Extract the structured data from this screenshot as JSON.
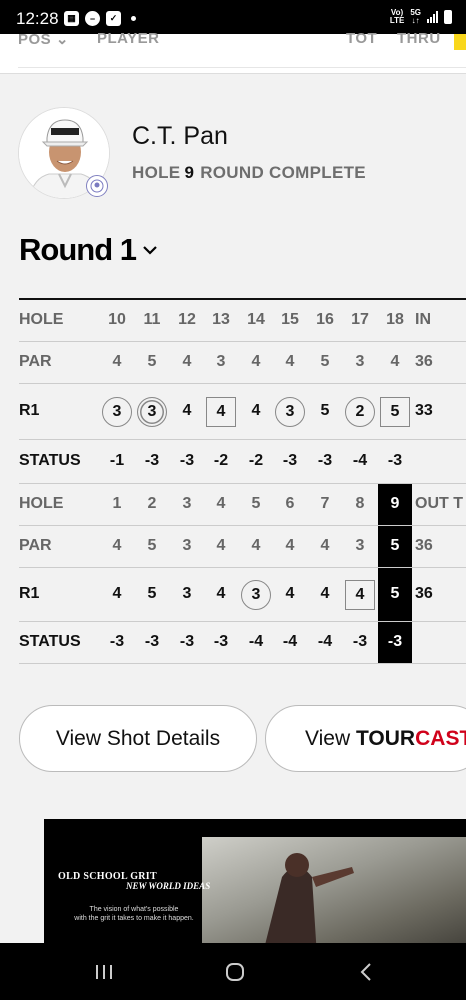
{
  "status_bar": {
    "time": "12:28",
    "net_top": "Vo)",
    "net_bottom": "LTE",
    "gen_top": "5G",
    "gen_bottom": "↓↑"
  },
  "header": {
    "pos": "POS",
    "player": "PLAYER",
    "tot": "TOT",
    "thru": "THRU"
  },
  "player": {
    "name": "C.T. Pan",
    "hole_label": "HOLE",
    "hole": "9",
    "round_status": "ROUND COMPLETE"
  },
  "round": {
    "title": "Round 1"
  },
  "back_nine": {
    "holes_label": "HOLE",
    "holes": [
      "10",
      "11",
      "12",
      "13",
      "14",
      "15",
      "16",
      "17",
      "18"
    ],
    "total_label": "IN",
    "par_label": "PAR",
    "par": [
      "4",
      "5",
      "4",
      "3",
      "4",
      "4",
      "5",
      "3",
      "4"
    ],
    "par_total": "36",
    "score_label": "R1",
    "scores": [
      "3",
      "3",
      "4",
      "4",
      "4",
      "3",
      "5",
      "2",
      "5"
    ],
    "score_marks": [
      "circle",
      "double-circle",
      "none",
      "square",
      "none",
      "circle",
      "none",
      "circle",
      "square"
    ],
    "score_total": "33",
    "status_label": "STATUS",
    "status": [
      "-1",
      "-3",
      "-3",
      "-2",
      "-2",
      "-3",
      "-3",
      "-4",
      "-3"
    ]
  },
  "front_nine": {
    "holes_label": "HOLE",
    "holes": [
      "1",
      "2",
      "3",
      "4",
      "5",
      "6",
      "7",
      "8",
      "9"
    ],
    "total_label": "OUT T",
    "par_label": "PAR",
    "par": [
      "4",
      "5",
      "3",
      "4",
      "4",
      "4",
      "4",
      "3",
      "5"
    ],
    "par_total": "36",
    "score_label": "R1",
    "scores": [
      "4",
      "5",
      "3",
      "4",
      "3",
      "4",
      "4",
      "4",
      "5"
    ],
    "score_marks": [
      "none",
      "none",
      "none",
      "none",
      "circle",
      "none",
      "none",
      "square",
      "none"
    ],
    "score_total": "36",
    "status_label": "STATUS",
    "status": [
      "-3",
      "-3",
      "-3",
      "-3",
      "-4",
      "-4",
      "-4",
      "-3",
      "-3"
    ]
  },
  "buttons": {
    "shot_details": "View Shot Details",
    "tourcast_prefix": "View ",
    "tourcast_tour": "TOUR",
    "tourcast_cast": "CAST"
  },
  "ad": {
    "line1": "OLD SCHOOL GRIT",
    "line2": "NEW WORLD IDEAS",
    "line3": "The vision of what's possible",
    "line4": "with the grit it takes to make it happen."
  },
  "colors": {
    "accent_red": "#d0021b",
    "accent_yellow": "#f9d71c",
    "current_hole_bg": "#000000"
  }
}
